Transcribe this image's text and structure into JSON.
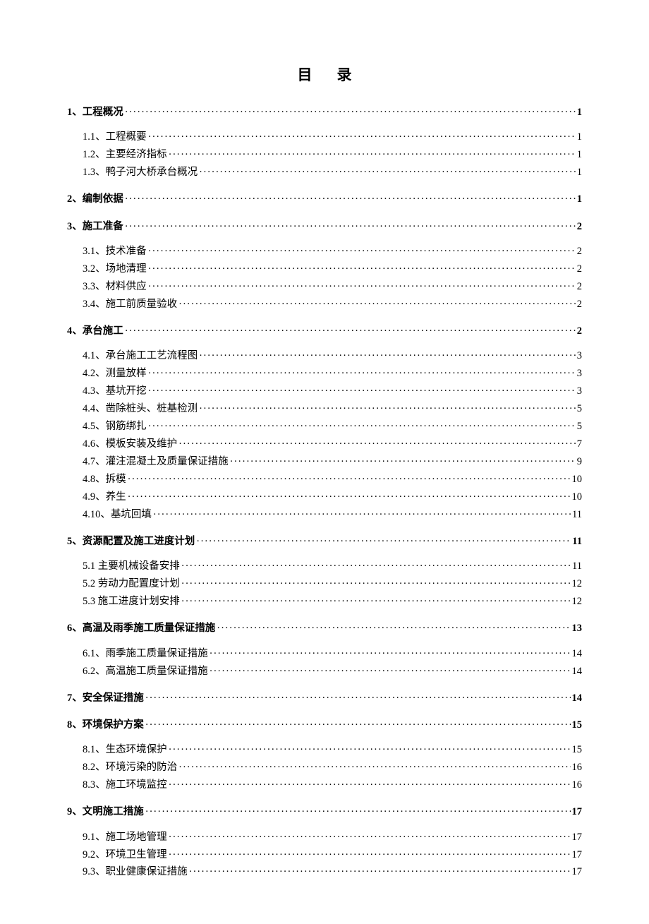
{
  "title": "目录",
  "toc": [
    {
      "level": 1,
      "label": "1、工程概况",
      "page": "1",
      "first": true
    },
    {
      "level": 2,
      "label": "1.1、工程概要",
      "page": "1"
    },
    {
      "level": 2,
      "label": "1.2、主要经济指标",
      "page": "1"
    },
    {
      "level": 2,
      "label": "1.3、鸭子河大桥承台概况",
      "page": "1"
    },
    {
      "level": 1,
      "label": "2、编制依据",
      "page": "1"
    },
    {
      "level": 1,
      "label": "3、施工准备",
      "page": "2"
    },
    {
      "level": 2,
      "label": "3.1、技术准备",
      "page": "2"
    },
    {
      "level": 2,
      "label": "3.2、场地清理",
      "page": "2"
    },
    {
      "level": 2,
      "label": "3.3、材料供应",
      "page": "2"
    },
    {
      "level": 2,
      "label": "3.4、施工前质量验收",
      "page": "2"
    },
    {
      "level": 1,
      "label": "4、承台施工",
      "page": "2"
    },
    {
      "level": 2,
      "label": "4.1、承台施工工艺流程图",
      "page": "3"
    },
    {
      "level": 2,
      "label": "4.2、测量放样",
      "page": "3"
    },
    {
      "level": 2,
      "label": "4.3、基坑开挖",
      "page": "3"
    },
    {
      "level": 2,
      "label": "4.4、凿除桩头、桩基检测",
      "page": "5"
    },
    {
      "level": 2,
      "label": "4.5、钢筋绑扎",
      "page": "5"
    },
    {
      "level": 2,
      "label": "4.6、模板安装及维护",
      "page": "7"
    },
    {
      "level": 2,
      "label": "4.7、灌注混凝土及质量保证措施",
      "page": "9"
    },
    {
      "level": 2,
      "label": "4.8、拆模",
      "page": "10"
    },
    {
      "level": 2,
      "label": "4.9、养生",
      "page": "10"
    },
    {
      "level": 2,
      "label": "4.10、基坑回填",
      "page": "11"
    },
    {
      "level": 1,
      "label": "5、资源配置及施工进度计划",
      "page": "11"
    },
    {
      "level": 2,
      "label": "5.1 主要机械设备安排",
      "page": "11"
    },
    {
      "level": 2,
      "label": "5.2 劳动力配置度计划",
      "page": "12"
    },
    {
      "level": 2,
      "label": "5.3 施工进度计划安排",
      "page": "12"
    },
    {
      "level": 1,
      "label": "6、高温及雨季施工质量保证措施",
      "page": "13"
    },
    {
      "level": 2,
      "label": "6.1、雨季施工质量保证措施",
      "page": "14"
    },
    {
      "level": 2,
      "label": "6.2、高温施工质量保证措施",
      "page": "14"
    },
    {
      "level": 1,
      "label": "7、安全保证措施",
      "page": "14"
    },
    {
      "level": 1,
      "label": "8、环境保护方案",
      "page": "15"
    },
    {
      "level": 2,
      "label": "8.1、生态环境保护",
      "page": "15"
    },
    {
      "level": 2,
      "label": "8.2、环境污染的防治",
      "page": "16"
    },
    {
      "level": 2,
      "label": "8.3、施工环境监控",
      "page": "16"
    },
    {
      "level": 1,
      "label": "9、文明施工措施",
      "page": "17"
    },
    {
      "level": 2,
      "label": "9.1、施工场地管理",
      "page": "17"
    },
    {
      "level": 2,
      "label": "9.2、环境卫生管理",
      "page": "17"
    },
    {
      "level": 2,
      "label": "9.3、职业健康保证措施",
      "page": "17"
    }
  ]
}
